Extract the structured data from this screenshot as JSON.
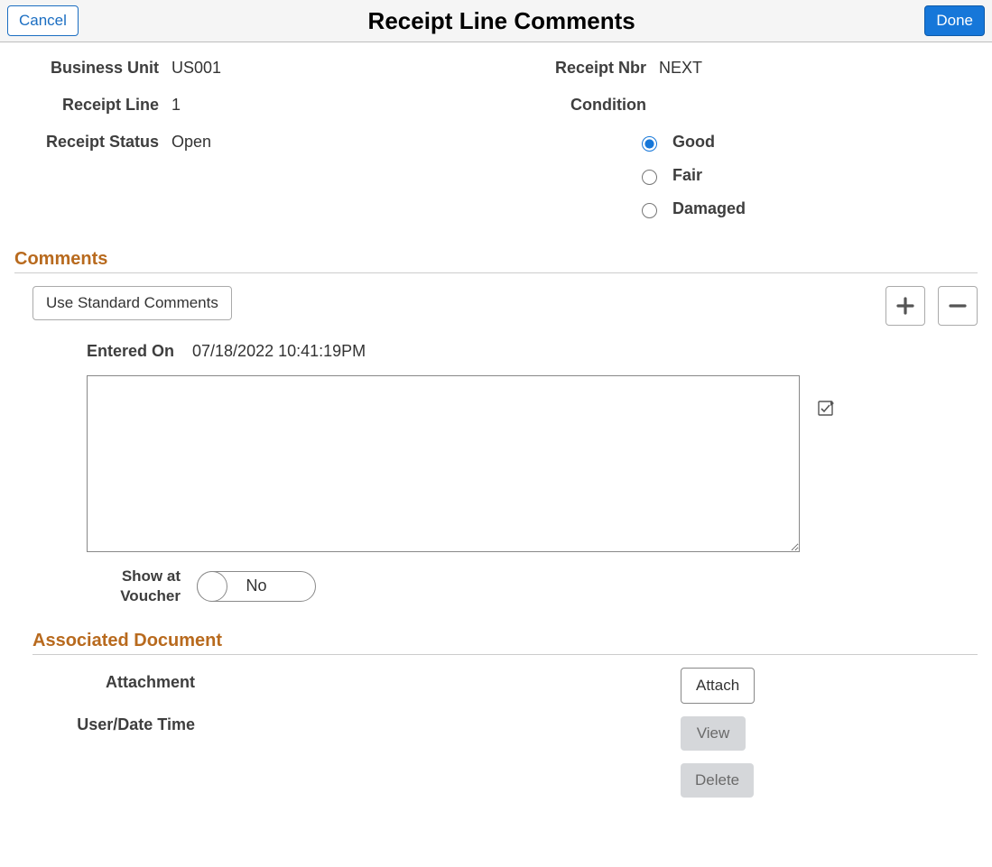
{
  "header": {
    "cancel": "Cancel",
    "title": "Receipt Line Comments",
    "done": "Done"
  },
  "info": {
    "business_unit_label": "Business Unit",
    "business_unit_value": "US001",
    "receipt_line_label": "Receipt Line",
    "receipt_line_value": "1",
    "receipt_status_label": "Receipt Status",
    "receipt_status_value": "Open",
    "receipt_nbr_label": "Receipt Nbr",
    "receipt_nbr_value": "NEXT",
    "condition_label": "Condition",
    "condition_options": {
      "good": "Good",
      "fair": "Fair",
      "damaged": "Damaged"
    },
    "condition_selected": "good"
  },
  "comments": {
    "heading": "Comments",
    "use_standard": "Use Standard Comments",
    "entered_on_label": "Entered On",
    "entered_on_value": "07/18/2022 10:41:19PM",
    "comment_text": "",
    "show_at_voucher_label": "Show at Voucher",
    "show_at_voucher_value": "No"
  },
  "associated": {
    "heading": "Associated Document",
    "attachment_label": "Attachment",
    "userdate_label": "User/Date Time",
    "attach_btn": "Attach",
    "view_btn": "View",
    "delete_btn": "Delete"
  }
}
